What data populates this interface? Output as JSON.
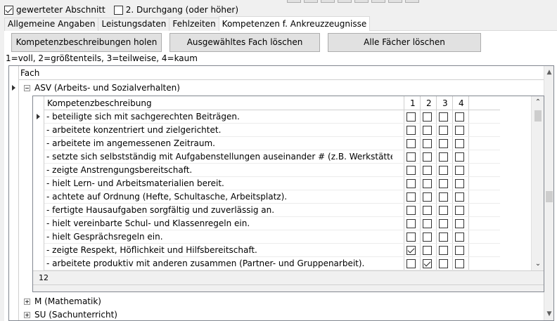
{
  "options": {
    "weighted_section": {
      "label": "gewerteter Abschnitt",
      "checked": true
    },
    "second_pass": {
      "label": "2. Durchgang (oder höher)",
      "checked": false
    }
  },
  "tabs": [
    {
      "label": "Allgemeine Angaben",
      "active": false
    },
    {
      "label": "Leistungsdaten",
      "active": false
    },
    {
      "label": "Fehlzeiten",
      "active": false
    },
    {
      "label": "Kompetenzen f. Ankreuzzeugnisse",
      "active": true
    }
  ],
  "buttons": {
    "fetch_label": "Kompetenzbeschreibungen holen",
    "delete_selected_label": "Ausgewähltes Fach löschen",
    "delete_all_label": "Alle Fächer löschen"
  },
  "legend": "1=voll, 2=größtenteils, 3=teilweise, 4=kaum",
  "tree": {
    "header": "Fach",
    "groups": [
      {
        "label": "ASV (Arbeits- und Sozialverhalten)",
        "expanded": true
      },
      {
        "label": "M (Mathematik)",
        "expanded": false
      },
      {
        "label": "SU (Sachunterricht)",
        "expanded": false
      }
    ]
  },
  "detail": {
    "header": "Kompetenzbeschreibung",
    "columns": [
      "1",
      "2",
      "3",
      "4"
    ],
    "row_count": "12",
    "rows": [
      {
        "text": "- beteiligte sich mit sachgerechten Beiträgen.",
        "rating": 0
      },
      {
        "text": "- arbeitete konzentriert und zielgerichtet.",
        "rating": 0
      },
      {
        "text": "- arbeitete im angemessenen Zeitraum.",
        "rating": 0
      },
      {
        "text": "- setzte sich selbstständig mit Aufgabenstellungen auseinander # (z.B. Werkstätten, Woche",
        "rating": 0
      },
      {
        "text": "- zeigte Anstrengungsbereitschaft.",
        "rating": 0
      },
      {
        "text": "- hielt Lern- und Arbeitsmaterialien bereit.",
        "rating": 0
      },
      {
        "text": "- achtete auf Ordnung (Hefte, Schultasche, Arbeitsplatz).",
        "rating": 0
      },
      {
        "text": "- fertigte Hausaufgaben sorgfältig und zuverlässig an.",
        "rating": 0
      },
      {
        "text": "- hielt vereinbarte Schul- und Klassenregeln ein.",
        "rating": 0
      },
      {
        "text": "- hielt Gesprächsregeln ein.",
        "rating": 0
      },
      {
        "text": "- zeigte Respekt, Höflichkeit und Hilfsbereitschaft.",
        "rating": 1
      },
      {
        "text": "- arbeitete produktiv mit anderen zusammen (Partner- und Gruppenarbeit).",
        "rating": 2
      }
    ]
  }
}
